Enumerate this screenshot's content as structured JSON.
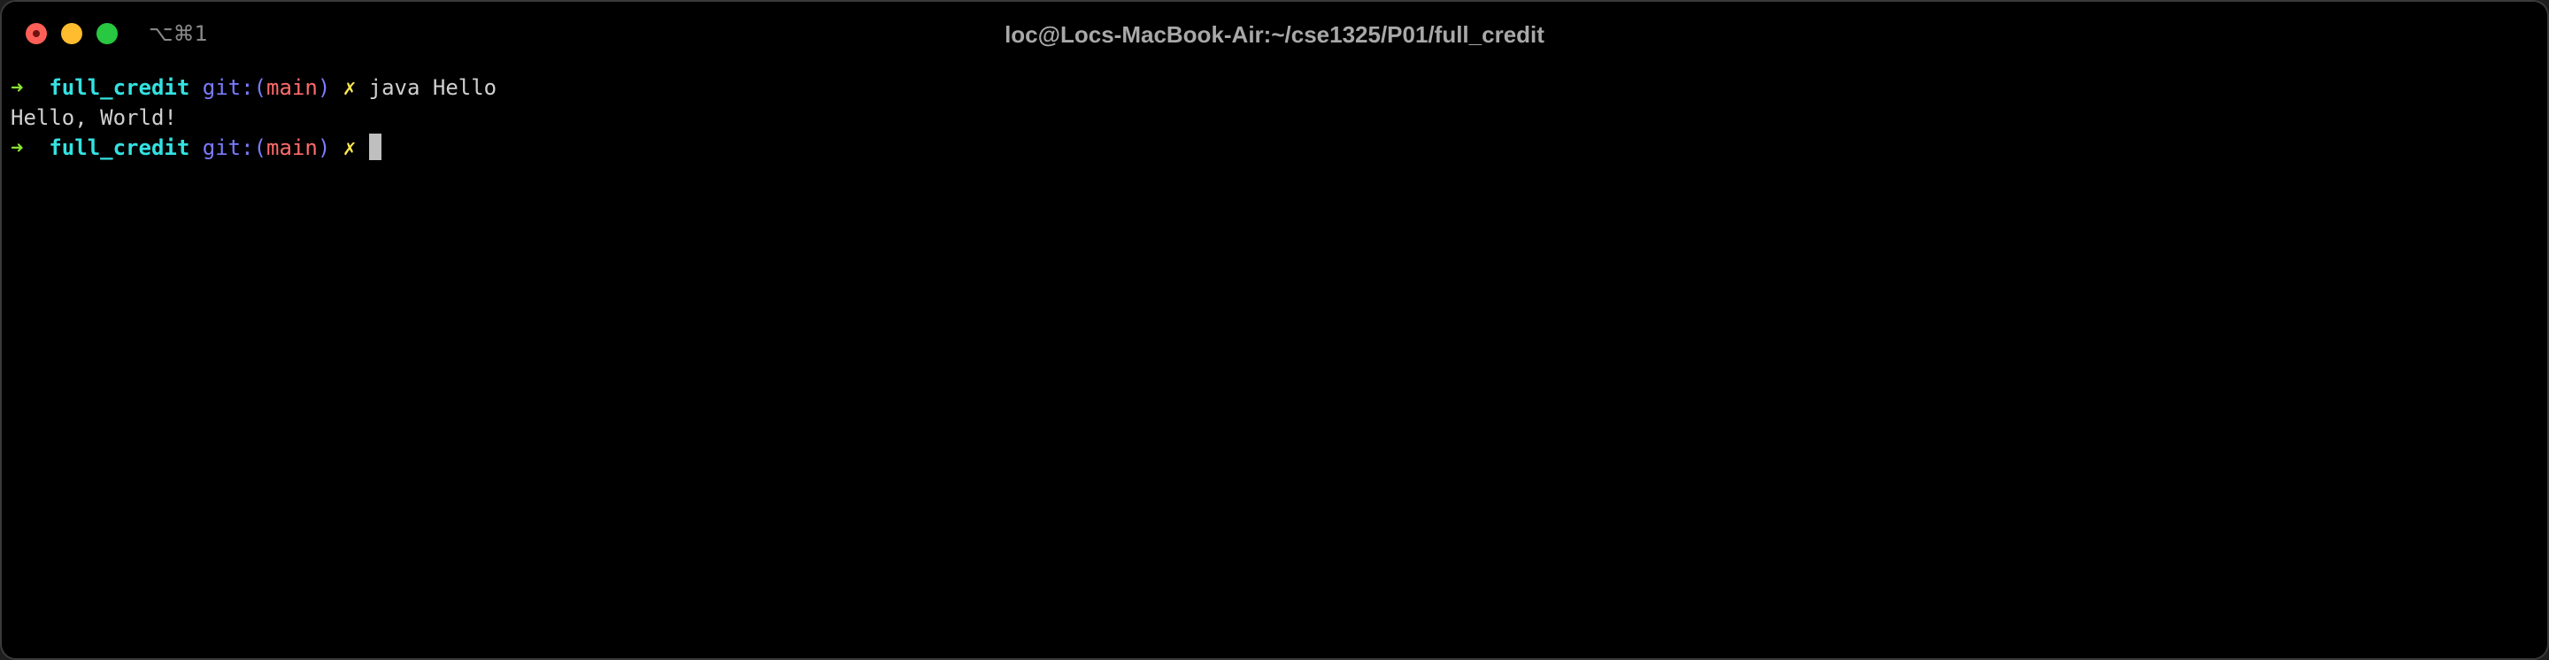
{
  "window": {
    "title": "loc@Locs-MacBook-Air:~/cse1325/P01/full_credit",
    "shortcut": "⌥⌘1"
  },
  "colors": {
    "close": "#ff5f57",
    "minimize": "#febc2e",
    "zoom": "#28c840",
    "prompt_arrow": "#8ae234",
    "directory": "#34e2e2",
    "git_label": "#7b7bff",
    "branch": "#ff6b6b",
    "dirty_mark": "#fce94f",
    "text": "#d0d0d0",
    "cursor": "#bfbfbf"
  },
  "terminal": {
    "lines": [
      {
        "type": "prompt",
        "arrow": "➜",
        "directory": "full_credit",
        "git_prefix": "git:(",
        "branch": "main",
        "git_suffix": ")",
        "dirty": "✗",
        "command": "java Hello"
      },
      {
        "type": "output",
        "text": "Hello, World!"
      },
      {
        "type": "prompt",
        "arrow": "➜",
        "directory": "full_credit",
        "git_prefix": "git:(",
        "branch": "main",
        "git_suffix": ")",
        "dirty": "✗",
        "command": ""
      }
    ]
  }
}
